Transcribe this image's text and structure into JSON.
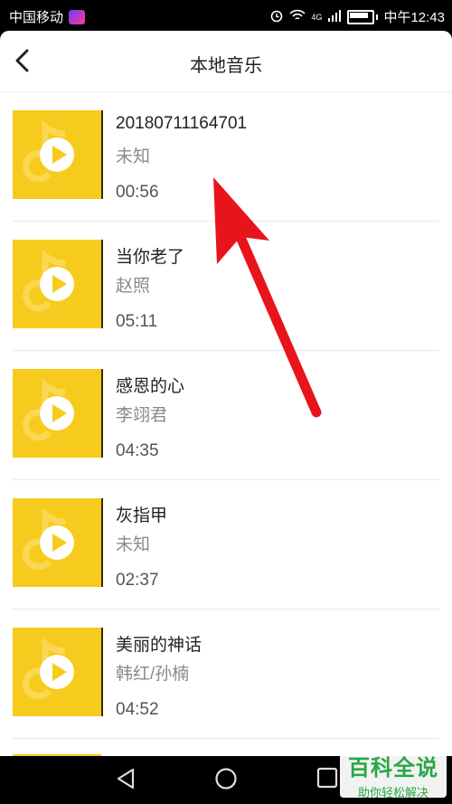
{
  "status_bar": {
    "carrier": "中国移动",
    "time": "中午12:43",
    "network": "4G"
  },
  "header": {
    "title": "本地音乐",
    "back_icon": "chevron-left-icon"
  },
  "songs": [
    {
      "title": "20180711164701",
      "artist": "未知",
      "duration": "00:56"
    },
    {
      "title": "当你老了",
      "artist": "赵照",
      "duration": "05:11"
    },
    {
      "title": "感恩的心",
      "artist": "李翊君",
      "duration": "04:35"
    },
    {
      "title": "灰指甲",
      "artist": "未知",
      "duration": "02:37"
    },
    {
      "title": "美丽的神话",
      "artist": "韩红/孙楠",
      "duration": "04:52"
    }
  ],
  "colors": {
    "album_art": "#f7cb1d",
    "annotation_arrow": "#e8141c",
    "watermark": "#27a845"
  },
  "nav_bar": {
    "back_icon": "triangle-back-icon",
    "home_icon": "circle-home-icon",
    "recents_icon": "square-recents-icon"
  },
  "watermark": {
    "main": "百科全说",
    "sub": "助你轻松解决"
  }
}
